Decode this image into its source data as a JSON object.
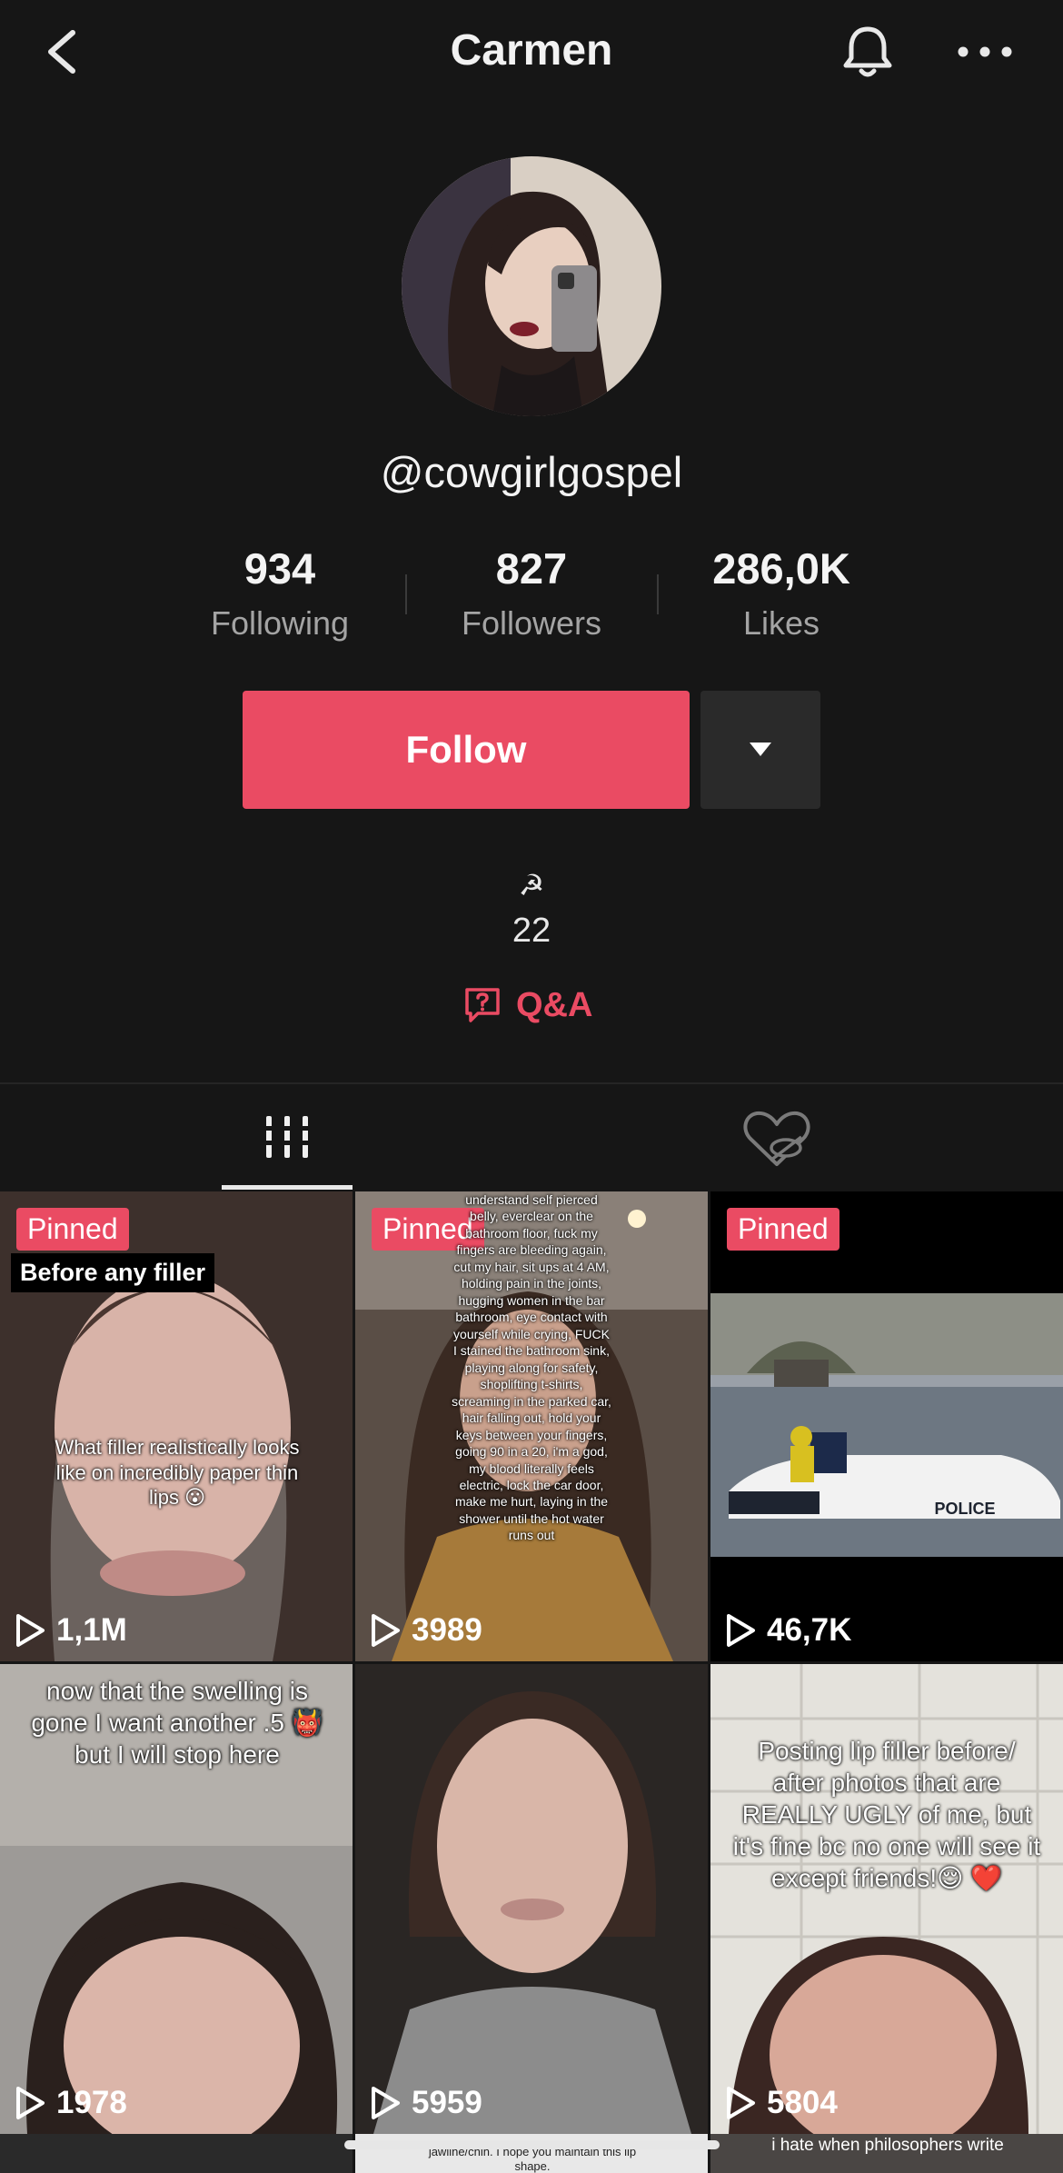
{
  "header": {
    "title": "Carmen",
    "icons": [
      "back-icon",
      "bell-icon",
      "more-icon"
    ]
  },
  "profile": {
    "handle": "@cowgirlgospel",
    "stats": [
      {
        "value": "934",
        "label": "Following"
      },
      {
        "value": "827",
        "label": "Followers"
      },
      {
        "value": "286,0K",
        "label": "Likes"
      }
    ],
    "follow_label": "Follow",
    "bio_emoji": "☭",
    "bio_text": "22",
    "qa_label": "Q&A"
  },
  "tabs": [
    {
      "name": "videos",
      "icon": "grid-icon",
      "active": true
    },
    {
      "name": "liked",
      "icon": "liked-hidden-icon",
      "active": false
    }
  ],
  "videos": [
    {
      "pinned_label": "Pinned",
      "views": "1,1M",
      "sticker": "Before any filler",
      "caption": "What filler realistically looks like on incredibly paper thin lips 😮"
    },
    {
      "pinned_label": "Pinned",
      "views": "3989",
      "caption": "understand self pierced belly, everclear on the bathroom floor, fuck my fingers are bleeding again, cut my hair, sit ups at 4 AM, holding pain in the joints, hugging women in the bar bathroom, eye contact with yourself while crying, FUCK I stained the bathroom sink, playing along for safety, shoplifting t-shirts, screaming in the parked car, hair falling out, hold your keys between your fingers, going 90 in a 20, i'm a god, my blood literally feels electric, lock the car door, make me hurt, laying in the shower until the hot water runs out"
    },
    {
      "pinned_label": "Pinned",
      "views": "46,7K",
      "caption": "POLICE"
    },
    {
      "views": "1978",
      "caption": "now that the swelling is gone I want another .5 👹 but I will stop here"
    },
    {
      "views": "5959"
    },
    {
      "views": "5804",
      "caption": "Posting lip filler before/ after photos that are REALLY UGLY of me, but it's fine bc no one will see it except friends!😌 ❤️"
    }
  ],
  "peek_captions": [
    "jawline/chin. I hope you maintain this lip shape.",
    "i hate when philosophers write"
  ],
  "colors": {
    "accent": "#ea4b63",
    "background": "#161616",
    "muted": "#a4a4a4"
  }
}
